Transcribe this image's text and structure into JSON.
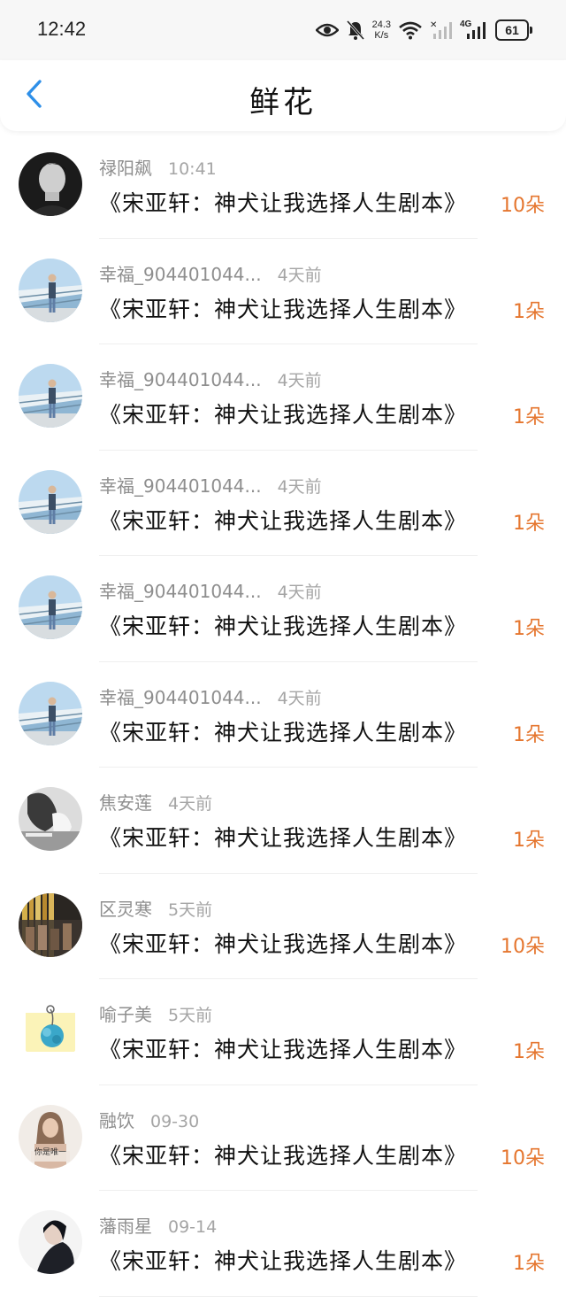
{
  "status_bar": {
    "time": "12:42",
    "net_speed_value": "24.3",
    "net_speed_unit": "K/s",
    "network_type": "4G",
    "battery": "61",
    "icons": [
      "eye-icon",
      "mute-bell-icon",
      "wifi-icon",
      "signal-off-icon",
      "signal-icon"
    ]
  },
  "header": {
    "title": "鲜花",
    "back_icon": "chevron-left-icon"
  },
  "colors": {
    "accent_blue": "#2e8fe8",
    "count_orange": "#e5762f"
  },
  "list": [
    {
      "user": "禄阳飙",
      "time": "10:41",
      "book": "《宋亚轩：神犬让我选择人生剧本》",
      "count": "10朵",
      "avatar": "dark"
    },
    {
      "user": "幸福_904401044...",
      "time": "4天前",
      "book": "《宋亚轩：神犬让我选择人生剧本》",
      "count": "1朵",
      "avatar": "bridge"
    },
    {
      "user": "幸福_904401044...",
      "time": "4天前",
      "book": "《宋亚轩：神犬让我选择人生剧本》",
      "count": "1朵",
      "avatar": "bridge"
    },
    {
      "user": "幸福_904401044...",
      "time": "4天前",
      "book": "《宋亚轩：神犬让我选择人生剧本》",
      "count": "1朵",
      "avatar": "bridge"
    },
    {
      "user": "幸福_904401044...",
      "time": "4天前",
      "book": "《宋亚轩：神犬让我选择人生剧本》",
      "count": "1朵",
      "avatar": "bridge"
    },
    {
      "user": "幸福_904401044...",
      "time": "4天前",
      "book": "《宋亚轩：神犬让我选择人生剧本》",
      "count": "1朵",
      "avatar": "bridge"
    },
    {
      "user": "焦安莲",
      "time": "4天前",
      "book": "《宋亚轩：神犬让我选择人生剧本》",
      "count": "1朵",
      "avatar": "smoke"
    },
    {
      "user": "区灵寒",
      "time": "5天前",
      "book": "《宋亚轩：神犬让我选择人生剧本》",
      "count": "10朵",
      "avatar": "books"
    },
    {
      "user": "喻子美",
      "time": "5天前",
      "book": "《宋亚轩：神犬让我选择人生剧本》",
      "count": "1朵",
      "avatar": "flower"
    },
    {
      "user": "融饮",
      "time": "09-30",
      "book": "《宋亚轩：神犬让我选择人生剧本》",
      "count": "10朵",
      "avatar": "girl",
      "avatar_text": "你是唯一"
    },
    {
      "user": "藩雨星",
      "time": "09-14",
      "book": "《宋亚轩：神犬让我选择人生剧本》",
      "count": "1朵",
      "avatar": "portrait"
    }
  ]
}
